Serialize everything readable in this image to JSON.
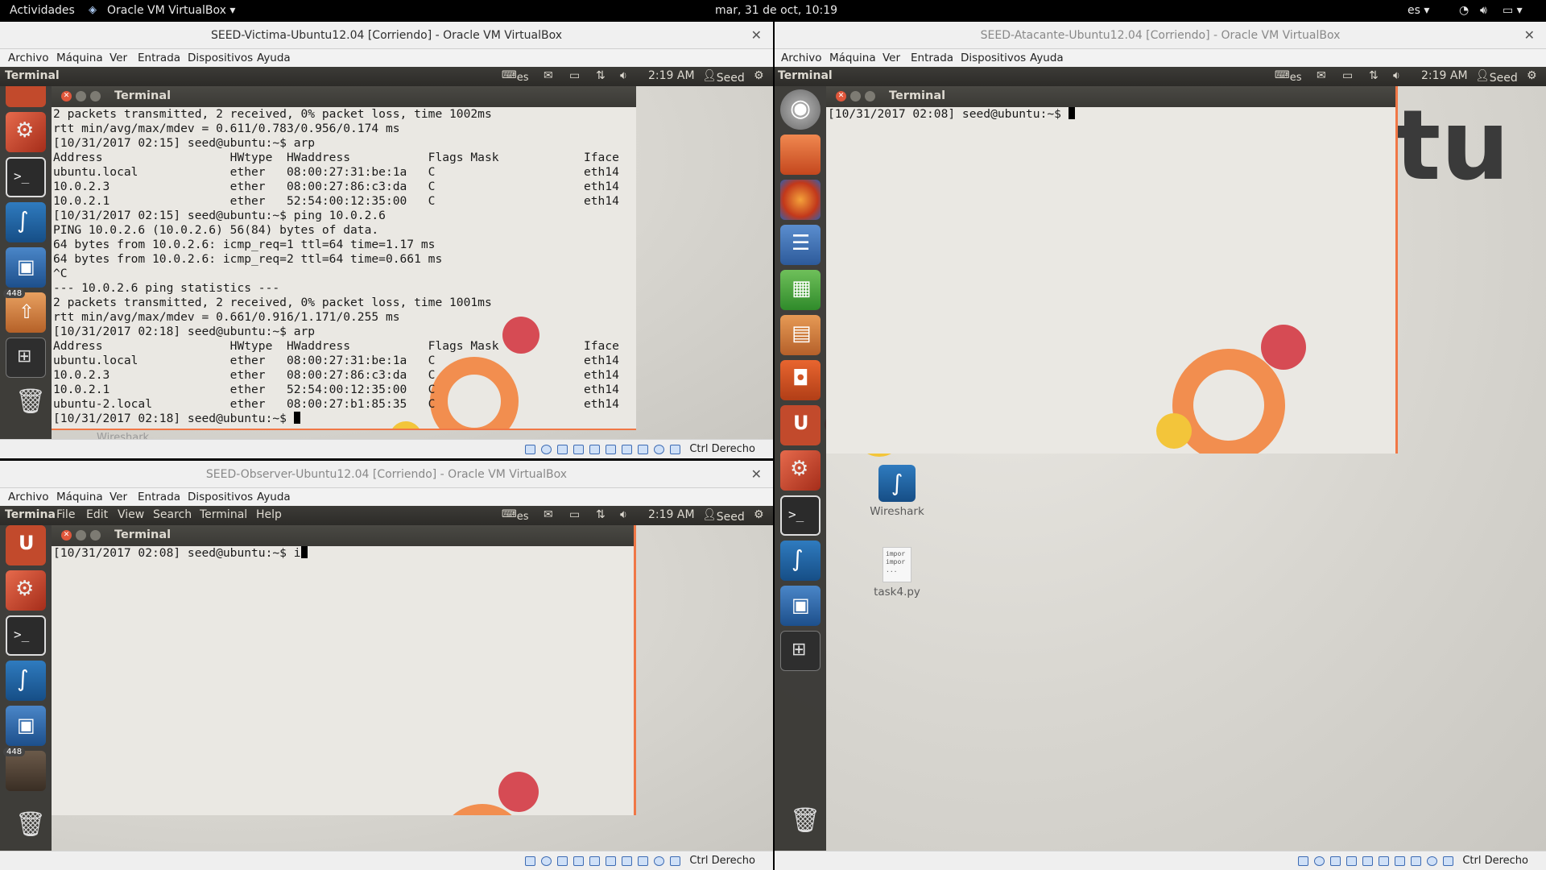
{
  "gnome_bar": {
    "activities": "Actividades",
    "app_name": "Oracle VM VirtualBox",
    "clock": "mar, 31 de oct, 10:19",
    "lang": "es"
  },
  "victim_window": {
    "title": "SEED-Victima-Ubuntu12.04 [Corriendo] - Oracle VM VirtualBox",
    "menu": [
      "Archivo",
      "Máquina",
      "Ver",
      "Entrada",
      "Dispositivos",
      "Ayuda"
    ],
    "panel": {
      "app": "Terminal",
      "kbd": "es",
      "time": "2:19 AM",
      "user": "Seed"
    },
    "launcher_badge": "448",
    "terminal": {
      "title": "Terminal",
      "lines": [
        "2 packets transmitted, 2 received, 0% packet loss, time 1002ms",
        "rtt min/avg/max/mdev = 0.611/0.783/0.956/0.174 ms",
        "[10/31/2017 02:15] seed@ubuntu:~$ arp",
        "Address                  HWtype  HWaddress           Flags Mask            Iface",
        "ubuntu.local             ether   08:00:27:31:be:1a   C                     eth14",
        "10.0.2.3                 ether   08:00:27:86:c3:da   C                     eth14",
        "10.0.2.1                 ether   52:54:00:12:35:00   C                     eth14",
        "[10/31/2017 02:15] seed@ubuntu:~$ ping 10.0.2.6",
        "PING 10.0.2.6 (10.0.2.6) 56(84) bytes of data.",
        "64 bytes from 10.0.2.6: icmp_req=1 ttl=64 time=1.17 ms",
        "64 bytes from 10.0.2.6: icmp_req=2 ttl=64 time=0.661 ms",
        "^C",
        "--- 10.0.2.6 ping statistics ---",
        "2 packets transmitted, 2 received, 0% packet loss, time 1001ms",
        "rtt min/avg/max/mdev = 0.661/0.916/1.171/0.255 ms",
        "[10/31/2017 02:18] seed@ubuntu:~$ arp",
        "Address                  HWtype  HWaddress           Flags Mask            Iface",
        "ubuntu.local             ether   08:00:27:31:be:1a   C                     eth14",
        "10.0.2.3                 ether   08:00:27:86:c3:da   C                     eth14",
        "10.0.2.1                 ether   52:54:00:12:35:00   C                     eth14",
        "ubuntu-2.local           ether   08:00:27:b1:85:35   C                     eth14"
      ],
      "prompt": "[10/31/2017 02:18] seed@ubuntu:~$ "
    },
    "desktop_label": "Wireshark",
    "status_host_key": "Ctrl Derecho"
  },
  "observer_window": {
    "title": "SEED-Observer-Ubuntu12.04 [Corriendo] - Oracle VM VirtualBox",
    "menu": [
      "Archivo",
      "Máquina",
      "Ver",
      "Entrada",
      "Dispositivos",
      "Ayuda"
    ],
    "panel": {
      "app": "Termina",
      "menus": [
        "File",
        "Edit",
        "View",
        "Search",
        "Terminal",
        "Help"
      ],
      "kbd": "es",
      "time": "2:19 AM",
      "user": "Seed"
    },
    "launcher_badge": "448",
    "terminal": {
      "title": "Terminal",
      "prompt": "[10/31/2017 02:08] seed@ubuntu:~$ ",
      "typed": "i"
    },
    "status_host_key": "Ctrl Derecho"
  },
  "attacker_window": {
    "title": "SEED-Atacante-Ubuntu12.04 [Corriendo] - Oracle VM VirtualBox",
    "menu": [
      "Archivo",
      "Máquina",
      "Ver",
      "Entrada",
      "Dispositivos",
      "Ayuda"
    ],
    "panel": {
      "app": "Terminal",
      "kbd": "es",
      "time": "2:19 AM",
      "user": "Seed"
    },
    "terminal": {
      "title": "Terminal",
      "prompt": "[10/31/2017 02:08] seed@ubuntu:~$ "
    },
    "desktop_icons": [
      {
        "label": "Wireshark",
        "icon": "wireshark-icon"
      },
      {
        "label": "task4.py",
        "icon": "python-file-icon",
        "thumb": [
          "impor",
          "impor",
          "..."
        ]
      }
    ],
    "status_host_key": "Ctrl Derecho"
  },
  "colors": {
    "accent_orange": "#f07746",
    "panel_dark": "#3c3b37",
    "close_red": "#e0573b"
  }
}
